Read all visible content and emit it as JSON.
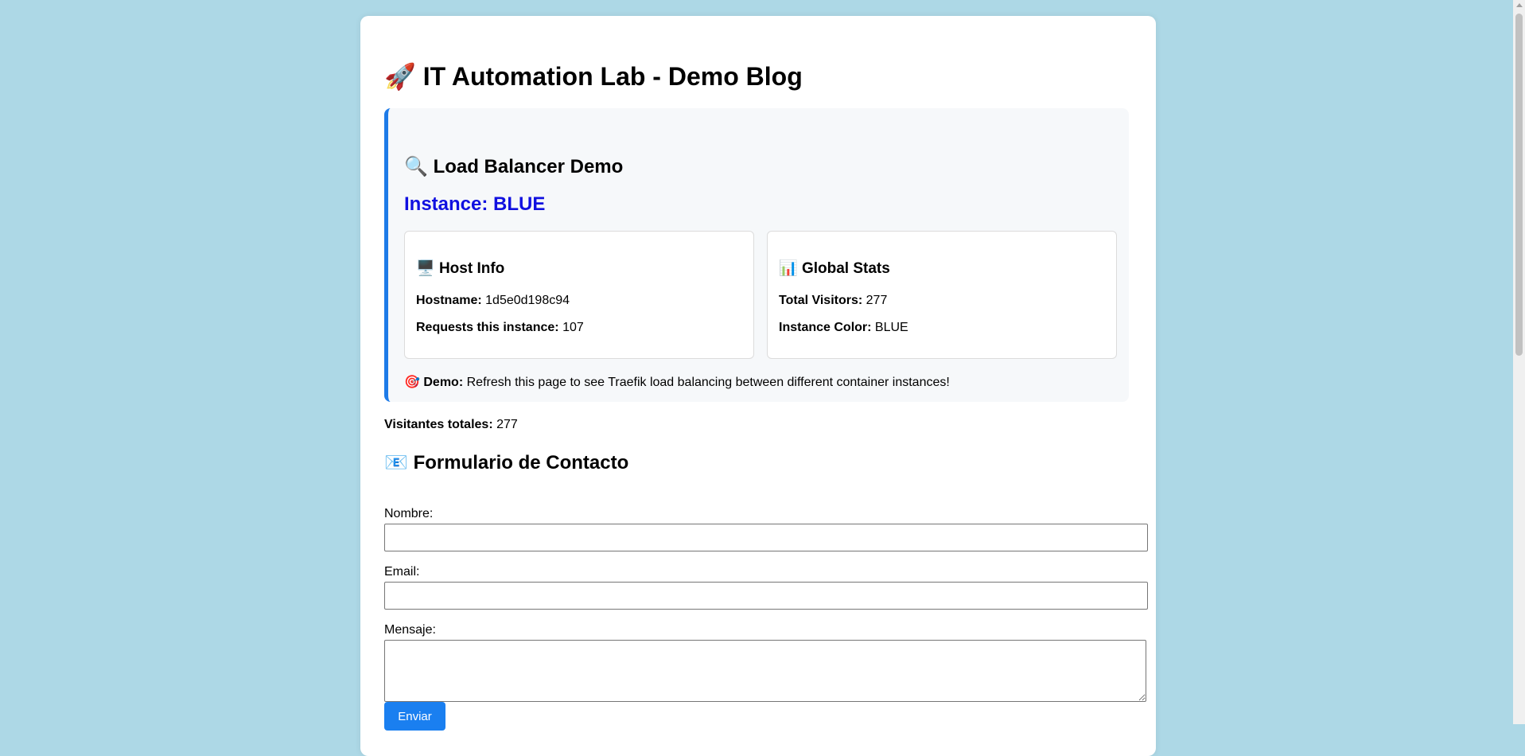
{
  "header": {
    "icon": "rocket-icon",
    "icon_glyph": "🚀",
    "title": "IT Automation Lab - Demo Blog"
  },
  "load_balancer": {
    "icon": "magnifier-icon",
    "icon_glyph": "🔍",
    "title": "Load Balancer Demo",
    "instance_label": "Instance:",
    "instance_value": "BLUE",
    "instance_color": "#1010e0",
    "accent_color": "#1e7be8",
    "host_info": {
      "icon": "monitor-icon",
      "icon_glyph": "🖥️",
      "title": "Host Info",
      "hostname_label": "Hostname:",
      "hostname_value": "1d5e0d198c94",
      "requests_label": "Requests this instance:",
      "requests_value": "107"
    },
    "global_stats": {
      "icon": "bar-chart-icon",
      "icon_glyph": "📊",
      "title": "Global Stats",
      "visitors_label": "Total Visitors:",
      "visitors_value": "277",
      "color_label": "Instance Color:",
      "color_value": "BLUE"
    },
    "demo_note": {
      "icon": "target-icon",
      "icon_glyph": "🎯",
      "label": "Demo:",
      "text": "Refresh this page to see Traefik load balancing between different container instances!"
    }
  },
  "visitors": {
    "label": "Visitantes totales:",
    "value": "277"
  },
  "contact_form": {
    "icon": "envelope-icon",
    "icon_glyph": "📧",
    "title": "Formulario de Contacto",
    "name_label": "Nombre:",
    "name_value": "",
    "email_label": "Email:",
    "email_value": "",
    "message_label": "Mensaje:",
    "message_value": "",
    "submit_label": "Enviar",
    "submit_color": "#1a7ff0"
  },
  "colors": {
    "page_background": "#add8e6",
    "card_background": "#ffffff",
    "panel_background": "#f6f8fa"
  }
}
